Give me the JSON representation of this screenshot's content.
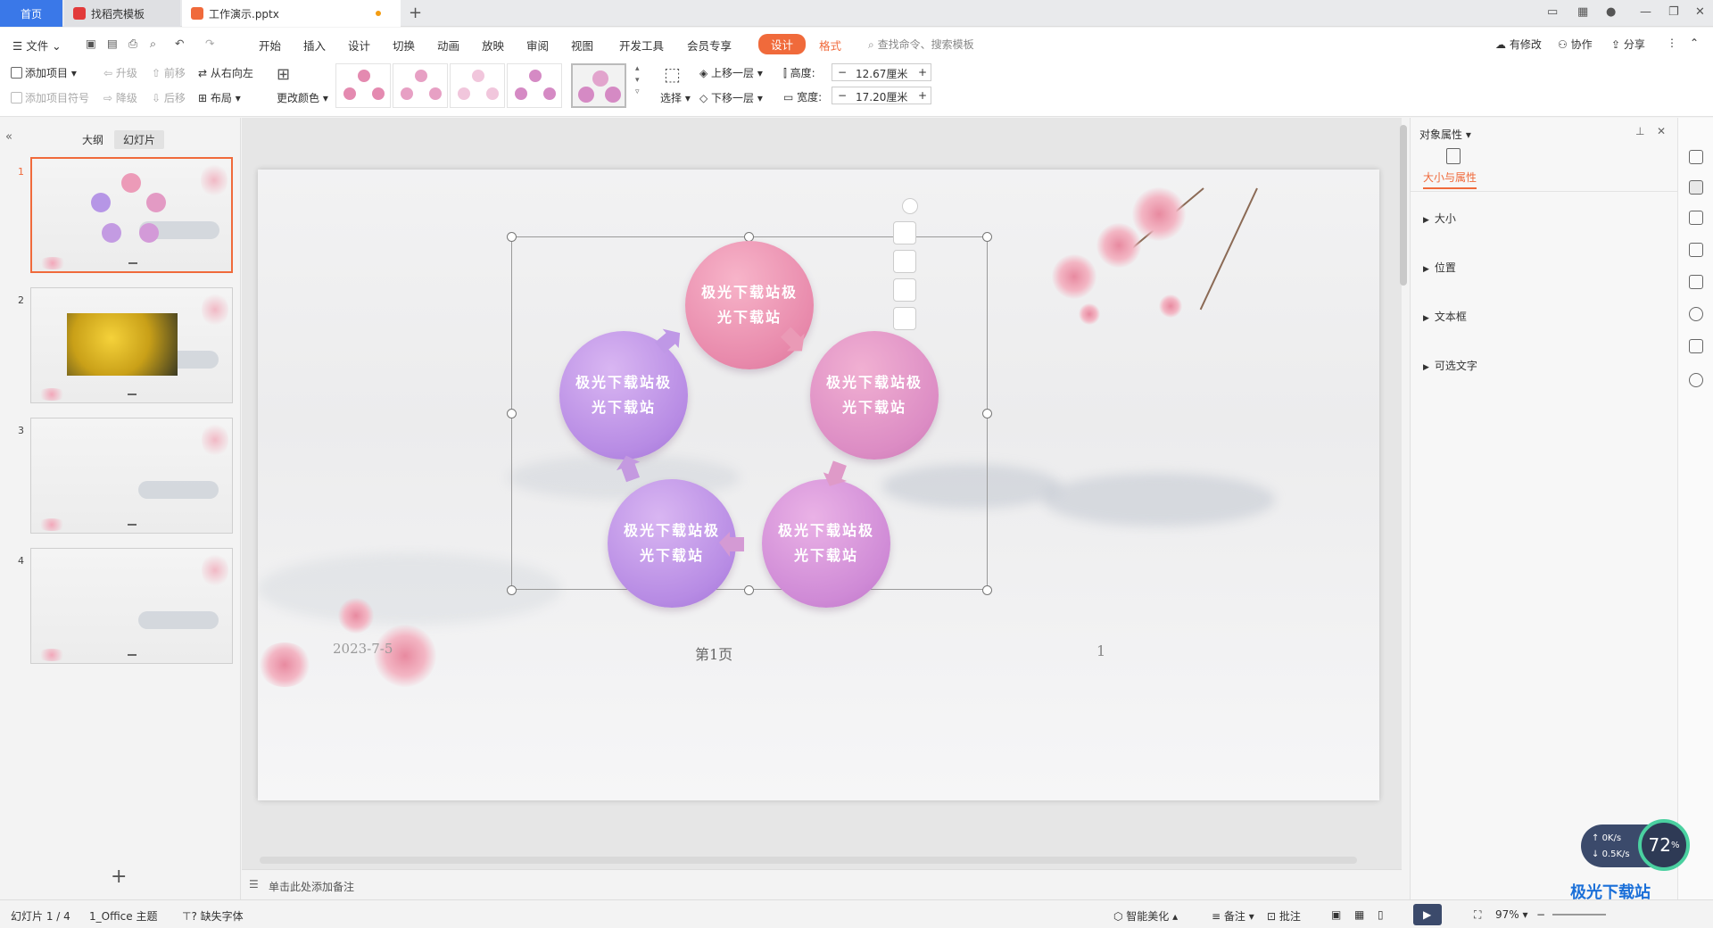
{
  "tabs": [
    {
      "label": "首页"
    },
    {
      "label": "找稻壳模板"
    },
    {
      "label": "工作演示.pptx"
    }
  ],
  "menu": {
    "file": "文件",
    "items": [
      "开始",
      "插入",
      "设计",
      "切换",
      "动画",
      "放映",
      "审阅",
      "视图",
      "开发工具",
      "会员专享"
    ],
    "design": "设计",
    "format": "格式",
    "search_placeholder": "查找命令、搜索模板",
    "right": [
      "有修改",
      "协作",
      "分享"
    ]
  },
  "ribbon": {
    "add_item": "添加项目",
    "add_bullet": "添加项目符号",
    "promote": "升级",
    "demote": "降级",
    "move_forward": "前移",
    "move_back": "后移",
    "rtl": "从右向左",
    "layout": "布局",
    "change_color": "更改颜色",
    "select": "选择",
    "bring_forward": "上移一层",
    "send_backward": "下移一层",
    "height_label": "高度:",
    "height_value": "12.67厘米",
    "width_label": "宽度:",
    "width_value": "17.20厘米"
  },
  "left_panel": {
    "tab_outline": "大纲",
    "tab_slides": "幻灯片",
    "slides": [
      "1",
      "2",
      "3",
      "4"
    ]
  },
  "slide": {
    "circles": [
      "极光下载站极光下载站",
      "极光下载站极光下载站",
      "极光下载站极光下载站",
      "极光下载站极光下载站",
      "极光下载站极光下载站"
    ],
    "footer_date": "2023-7-5",
    "footer_page": "第1页",
    "footer_num": "1"
  },
  "notes_placeholder": "单击此处添加备注",
  "right_panel": {
    "title": "对象属性",
    "tab": "大小与属性",
    "sections": [
      "大小",
      "位置",
      "文本框",
      "可选文字"
    ]
  },
  "status": {
    "slide_count": "幻灯片 1 / 4",
    "theme": "1_Office 主题",
    "missing_font": "缺失字体",
    "smart": "智能美化",
    "notes": "备注",
    "comment": "批注",
    "zoom": "97%"
  },
  "speed": {
    "up": "0K/s",
    "down": "0.5K/s",
    "percent": "72"
  },
  "watermark": "极光下载站"
}
